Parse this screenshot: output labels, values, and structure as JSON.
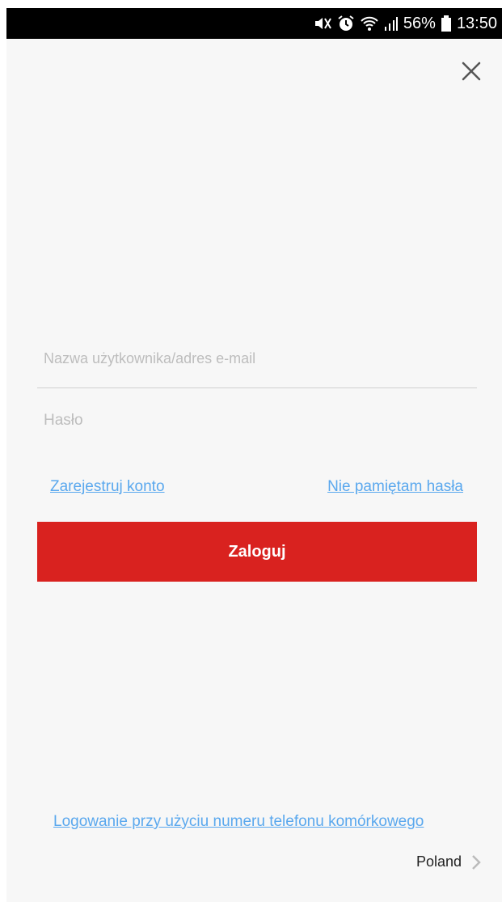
{
  "status_bar": {
    "battery_percent": "56%",
    "time": "13:50",
    "icons": [
      "mute-icon",
      "alarm-icon",
      "wifi-icon",
      "signal-icon",
      "battery-icon"
    ]
  },
  "login_form": {
    "username_placeholder": "Nazwa użytkownika/adres e-mail",
    "username_value": "",
    "password_placeholder": "Hasło",
    "password_value": "",
    "register_link": "Zarejestruj konto",
    "forgot_link": "Nie pamiętam hasła",
    "login_button": "Zaloguj"
  },
  "footer": {
    "phone_login_link": "Logowanie przy użyciu numeru telefonu komórkowego",
    "region": "Poland"
  },
  "colors": {
    "accent": "#d9221f",
    "link": "#5aa8ee",
    "background": "#f7f7f7"
  }
}
